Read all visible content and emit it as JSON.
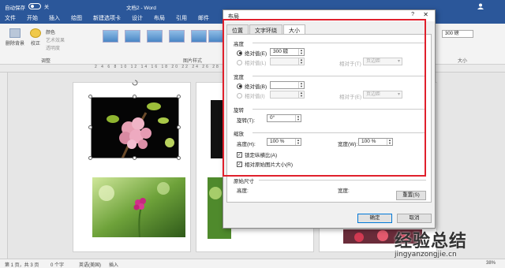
{
  "window": {
    "autosave_label": "自动保存",
    "autosave_state": "关",
    "doc_title": "文档2 - Word",
    "controls": [
      "?",
      "—",
      "□",
      "✕"
    ]
  },
  "ribbon_tabs": [
    "文件",
    "开始",
    "插入",
    "绘图",
    "新建选项卡",
    "设计",
    "布局",
    "引用",
    "邮件"
  ],
  "ribbon": {
    "remove_bg": "删除背景",
    "corrections": "校正",
    "color": "颜色",
    "artistic": "艺术效果",
    "transparency": "透明度",
    "adjust_group": "调整",
    "styles_group": "图片样式",
    "size_group": "大小",
    "height_value": "300 磅"
  },
  "ruler_text": "2 4 6 8 10 12 14 16 18 20 22 24 26 28 30 32 34 36 38 40 42 44 46",
  "dialog": {
    "title": "布局",
    "help": "?",
    "close": "✕",
    "tabs": [
      "位置",
      "文字环绕",
      "大小"
    ],
    "height_section": "高度",
    "abs_label": "绝对值(E)",
    "rel_label": "相对值(L)",
    "height_abs_value": "300 磅",
    "relative_to_label": "相对于(T)",
    "relative_to_w_label": "相对于(E)",
    "page_option": "页边距",
    "width_section": "宽度",
    "width_abs_label": "绝对值(B)",
    "width_rel_label": "相对值(I)",
    "rotate_section": "旋转",
    "rotate_label": "旋转(T):",
    "rotate_value": "0°",
    "scale_section": "缩放",
    "scale_h_label": "高度(H):",
    "scale_h_value": "100 %",
    "scale_w_label": "宽度(W):",
    "scale_w_value": "100 %",
    "lock_aspect": "锁定纵横比(A)",
    "relative_original": "相对原始图片大小(R)",
    "original_size_section": "原始尺寸",
    "orig_h_label": "高度:",
    "orig_w_label": "宽度:",
    "reset_button": "重置(S)",
    "ok_button": "确定",
    "cancel_button": "取消"
  },
  "status": {
    "page": "第 1 页，共 3 页",
    "words": "0 个字",
    "lang": "英语(美国)",
    "mode": "插入",
    "zoom": "38%"
  },
  "watermark": {
    "line1": "经验总结",
    "line2": "jingyanzongjie.cn"
  },
  "colors": {
    "word_blue": "#2b579a",
    "highlight_red": "#e0202c"
  }
}
